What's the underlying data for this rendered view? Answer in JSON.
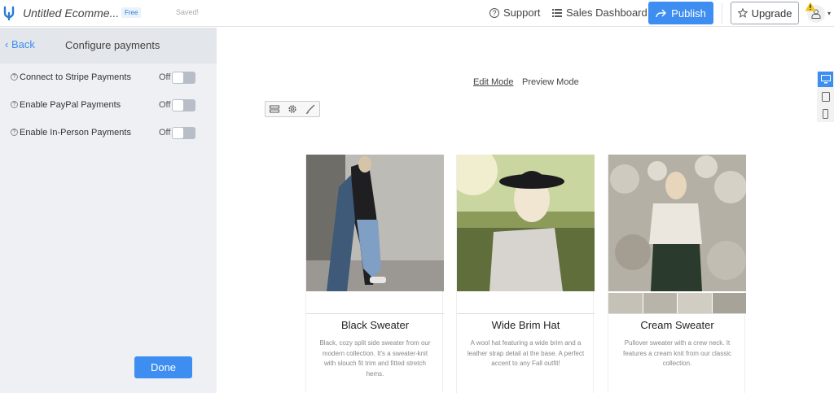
{
  "header": {
    "site_title": "Untitled Ecomme...",
    "plan_badge": "Free",
    "save_status": "Saved!",
    "support_label": "Support",
    "dashboard_label": "Sales Dashboard",
    "publish_label": "Publish",
    "upgrade_label": "Upgrade"
  },
  "panel": {
    "back_label": "Back",
    "title": "Configure payments",
    "rows": [
      {
        "label": "Connect to Stripe Payments",
        "state": "Off"
      },
      {
        "label": "Enable PayPal Payments",
        "state": "Off"
      },
      {
        "label": "Enable In-Person Payments",
        "state": "Off"
      }
    ],
    "done_label": "Done"
  },
  "canvas": {
    "edit_mode_label": "Edit Mode",
    "preview_mode_label": "Preview Mode",
    "products": [
      {
        "name": "Black Sweater",
        "description": "Black, cozy split side sweater from our modern collection. It's a sweater-knit with slouch fit trim and fitted stretch hems."
      },
      {
        "name": "Wide Brim Hat",
        "description": "A wool hat featuring a wide brim and a leather strap detail at the base. A perfect accent to any Fall outfit!"
      },
      {
        "name": "Cream Sweater",
        "description": "Pullover sweater with a crew neck. It features a cream knit from our classic collection."
      }
    ]
  },
  "colors": {
    "accent": "#3d8ef0",
    "panel_bg": "#eef0f3",
    "toggle_off": "#b8bec7"
  }
}
